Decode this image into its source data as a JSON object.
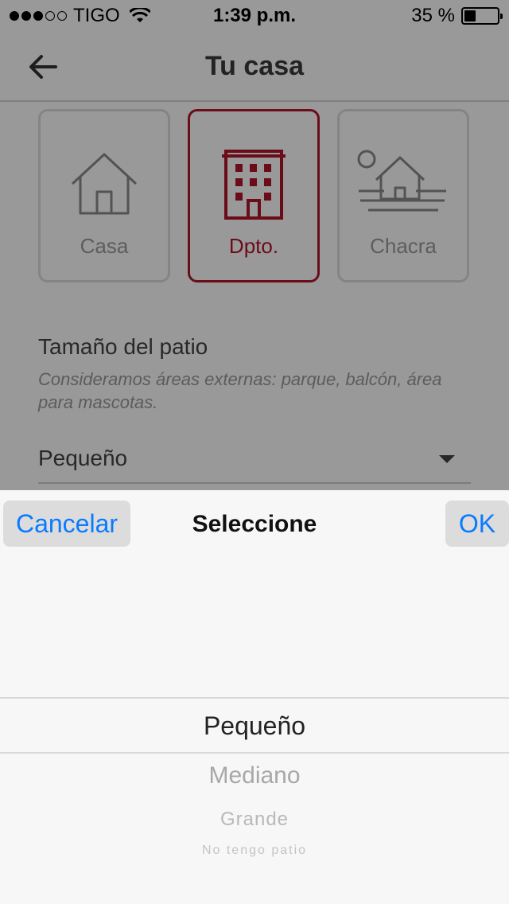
{
  "status_bar": {
    "carrier": "TIGO",
    "time": "1:39 p.m.",
    "battery": "35 %",
    "battery_level": 0.35
  },
  "nav": {
    "title": "Tu casa",
    "back_icon": "arrow-left-icon"
  },
  "property_types": [
    {
      "label": "Casa",
      "icon": "house-icon",
      "selected": false
    },
    {
      "label": "Dpto.",
      "icon": "building-icon",
      "selected": true
    },
    {
      "label": "Chacra",
      "icon": "farm-icon",
      "selected": false
    }
  ],
  "patio": {
    "title": "Tamaño del patio",
    "hint": "Consideramos áreas externas: parque, balcón, área para mascotas.",
    "selected_value": "Pequeño"
  },
  "picker": {
    "cancel_label": "Cancelar",
    "title": "Seleccione",
    "ok_label": "OK",
    "options": [
      "Pequeño",
      "Mediano",
      "Grande",
      "No tengo patio"
    ]
  },
  "colors": {
    "accent": "#b3162b",
    "ios_blue": "#0a7aff"
  }
}
